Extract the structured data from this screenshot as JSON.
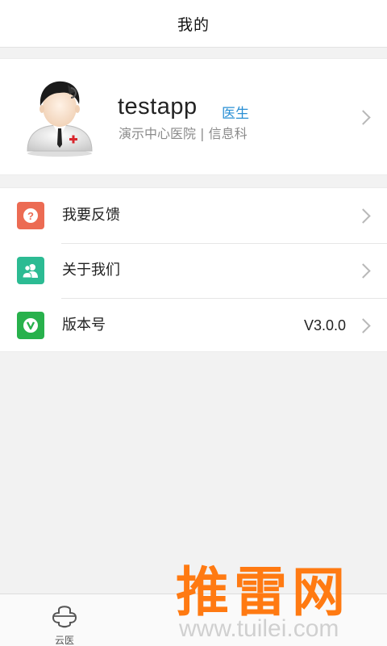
{
  "header": {
    "title": "我的"
  },
  "profile": {
    "username": "testapp",
    "role": "医生",
    "hospital": "演示中心医院",
    "separator": "|",
    "department": "信息科"
  },
  "menu": {
    "items": [
      {
        "label": "我要反馈",
        "icon": "question-icon",
        "color": "#ec6b53",
        "value": ""
      },
      {
        "label": "关于我们",
        "icon": "users-icon",
        "color": "#2cbb93",
        "value": ""
      },
      {
        "label": "版本号",
        "icon": "v-icon",
        "color": "#28b14c",
        "value": "V3.0.0"
      }
    ]
  },
  "tabbar": {
    "tabs": [
      {
        "label": "云医",
        "icon": "cloud-medical-icon"
      }
    ]
  },
  "watermark": {
    "title": "推雷网",
    "url": "www.tuilei.com",
    "color": "#ff7a12"
  }
}
